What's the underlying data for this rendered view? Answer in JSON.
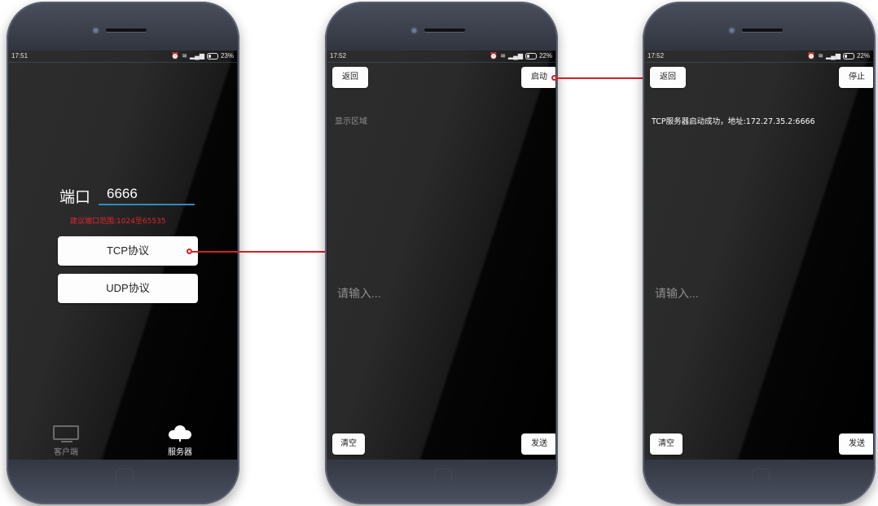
{
  "phone1": {
    "status": {
      "time": "17:51",
      "battery": "23%"
    },
    "port_label": "端口",
    "port_value": "6666",
    "hint": "建议端口范围:1024至65535",
    "tcp_label": "TCP协议",
    "udp_label": "UDP协议",
    "tabs": [
      {
        "label": "客户端",
        "icon": "monitor-icon"
      },
      {
        "label": "服务器",
        "icon": "cloud-icon"
      }
    ]
  },
  "phone2": {
    "status": {
      "time": "17:52",
      "battery": "22%"
    },
    "back_label": "返回",
    "start_label": "启动",
    "display_placeholder": "显示区域",
    "input_placeholder": "请输入...",
    "clear_label": "清空",
    "send_label": "发送"
  },
  "phone3": {
    "status": {
      "time": "17:52",
      "battery": "22%"
    },
    "back_label": "返回",
    "stop_label": "停止",
    "message": "TCP服务器启动成功，地址:172.27.35.2:6666",
    "input_placeholder": "请输入...",
    "clear_label": "清空",
    "send_label": "发送"
  },
  "colors": {
    "accent": "#d12028",
    "underline": "#2e8bc0",
    "hint": "#e0262c"
  }
}
